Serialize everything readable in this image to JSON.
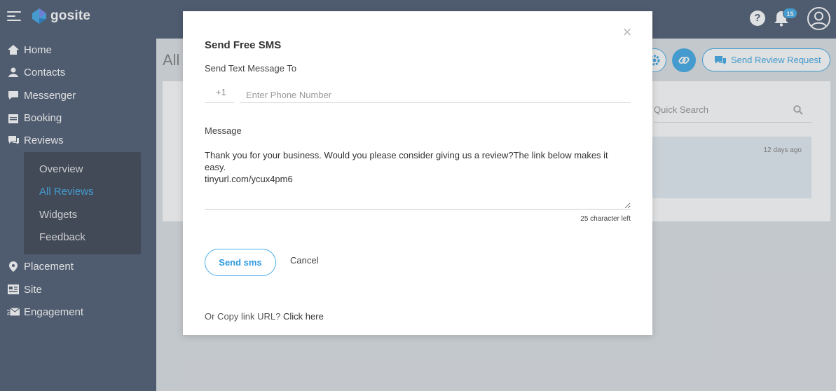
{
  "brand": {
    "name": "gosite",
    "accent": "#4aaee8",
    "sidebar_bg": "#566379"
  },
  "topbar": {
    "help_icon": "?",
    "notifications_count": "15"
  },
  "sidebar": {
    "items": [
      {
        "label": "Home",
        "icon": "home-icon"
      },
      {
        "label": "Contacts",
        "icon": "contacts-icon"
      },
      {
        "label": "Messenger",
        "icon": "messenger-icon"
      },
      {
        "label": "Booking",
        "icon": "booking-icon"
      },
      {
        "label": "Reviews",
        "icon": "reviews-icon"
      },
      {
        "label": "Placement",
        "icon": "placement-icon"
      },
      {
        "label": "Site",
        "icon": "site-icon"
      },
      {
        "label": "Engagement",
        "icon": "engagement-icon"
      }
    ],
    "submenu": [
      {
        "label": "Overview"
      },
      {
        "label": "All Reviews",
        "active": true
      },
      {
        "label": "Widgets"
      },
      {
        "label": "Feedback"
      }
    ]
  },
  "main": {
    "title_partial": "All",
    "send_review_label": "Send Review Request",
    "search_placeholder": "Quick Search",
    "row_time": "12 days ago"
  },
  "modal": {
    "title": "Send Free SMS",
    "to_label": "Send Text Message To",
    "country_code": "+1",
    "phone_placeholder": "Enter Phone Number",
    "message_label": "Message",
    "message_text": "Thank you for your business. Would you please consider giving us a review?The link below makes it easy.\ntinyurl.com/ycux4pm6",
    "chars_left": "25 character left",
    "send_label": "Send sms",
    "cancel_label": "Cancel",
    "copy_prefix": "Or Copy link URL?",
    "copy_link": "Click here"
  }
}
